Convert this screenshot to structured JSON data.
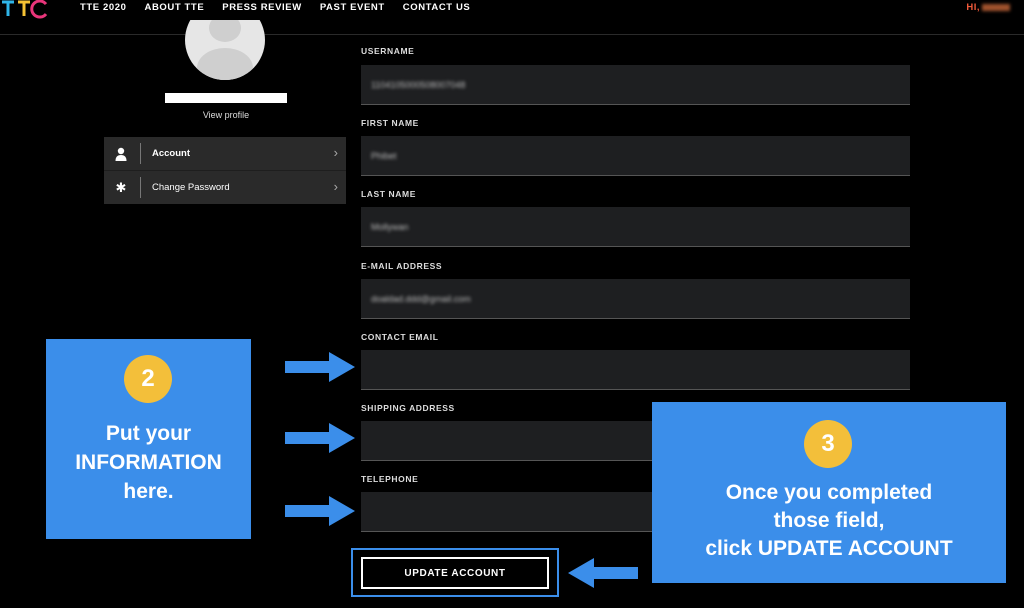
{
  "nav": {
    "items": [
      "TTE 2020",
      "ABOUT TTE",
      "PRESS REVIEW",
      "PAST EVENT",
      "CONTACT US"
    ],
    "greeting": "HI,"
  },
  "profile": {
    "view_profile": "View profile"
  },
  "menu": {
    "items": [
      {
        "label": "Account",
        "icon": "user-icon"
      },
      {
        "label": "Change Password",
        "icon": "asterisk-icon"
      }
    ]
  },
  "form": {
    "username": {
      "label": "USERNAME",
      "value": "1104105000508007048"
    },
    "first_name": {
      "label": "FIRST NAME",
      "value": "Phibet"
    },
    "last_name": {
      "label": "LAST NAME",
      "value": "Mollywan"
    },
    "email": {
      "label": "E-MAIL ADDRESS",
      "value": "doaldad.ddd@gmail.com"
    },
    "contact_email": {
      "label": "CONTACT EMAIL",
      "value": ""
    },
    "shipping_address": {
      "label": "SHIPPING ADDRESS",
      "value": ""
    },
    "telephone": {
      "label": "TELEPHONE",
      "value": ""
    },
    "update_button": "UPDATE ACCOUNT"
  },
  "callouts": {
    "step2": {
      "number": "2",
      "lines": [
        "Put your",
        "INFORMATION",
        "here."
      ]
    },
    "step3": {
      "number": "3",
      "lines": [
        "Once you completed",
        "those field,",
        "click UPDATE ACCOUNT"
      ]
    }
  },
  "colors": {
    "accent_blue": "#3b8eea",
    "badge_yellow": "#f3bf3a",
    "greeting_orange": "#f15a3a",
    "field_bg": "#1e1f21"
  }
}
